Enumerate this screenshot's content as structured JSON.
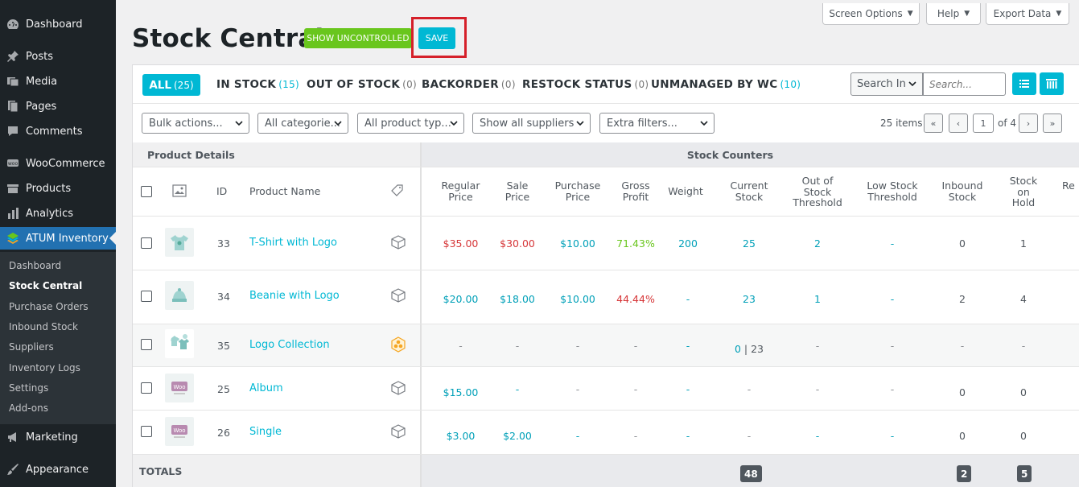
{
  "sidebar": {
    "items": [
      {
        "label": "Dashboard",
        "icon": "dashboard-icon"
      },
      {
        "label": "Posts",
        "icon": "pin-icon"
      },
      {
        "label": "Media",
        "icon": "media-icon"
      },
      {
        "label": "Pages",
        "icon": "pages-icon"
      },
      {
        "label": "Comments",
        "icon": "comments-icon"
      },
      {
        "label": "WooCommerce",
        "icon": "woo-icon"
      },
      {
        "label": "Products",
        "icon": "products-icon"
      },
      {
        "label": "Analytics",
        "icon": "analytics-icon"
      },
      {
        "label": "ATUM Inventory",
        "icon": "atum-layers-icon"
      },
      {
        "label": "Marketing",
        "icon": "megaphone-icon"
      },
      {
        "label": "Appearance",
        "icon": "paintbrush-icon"
      }
    ],
    "submenu": [
      "Dashboard",
      "Stock Central",
      "Purchase Orders",
      "Inbound Stock",
      "Suppliers",
      "Inventory Logs",
      "Settings",
      "Add-ons"
    ],
    "current_submenu": "Stock Central"
  },
  "top_buttons": {
    "screen_options": "Screen Options",
    "help": "Help",
    "export": "Export Data"
  },
  "page_title": "Stock Central",
  "buttons": {
    "show_uncontrolled": "SHOW UNCONTROLLED",
    "save": "SAVE"
  },
  "views": [
    {
      "label": "ALL",
      "count": "(25)"
    },
    {
      "label": "IN STOCK",
      "count": "(15)"
    },
    {
      "label": "OUT OF STOCK",
      "count": "(0)"
    },
    {
      "label": "BACKORDER",
      "count": "(0)"
    },
    {
      "label": "RESTOCK STATUS",
      "count": "(0)"
    },
    {
      "label": "UNMANAGED BY WC",
      "count": "(10)"
    }
  ],
  "search": {
    "select_label": "Search In",
    "placeholder": "Search..."
  },
  "filters": [
    "Bulk actions...",
    "All categorie...",
    "All product typ...",
    "Show all suppliers",
    "Extra filters..."
  ],
  "pagination": {
    "items": "25 items",
    "first": "«",
    "prev": "‹",
    "current": "1",
    "of": "of 4",
    "next": "›",
    "last": "»"
  },
  "table": {
    "group_left": "Product Details",
    "group_right": "Stock Counters",
    "headers": {
      "id": "ID",
      "name": "Product Name",
      "regular_price": [
        "Regular",
        "Price"
      ],
      "sale_price": [
        "Sale",
        "Price"
      ],
      "purchase_price": [
        "Purchase",
        "Price"
      ],
      "gross_profit": [
        "Gross",
        "Profit"
      ],
      "weight": [
        "Weight"
      ],
      "current_stock": [
        "Current",
        "Stock"
      ],
      "out_of_stock_threshold": [
        "Out of",
        "Stock",
        "Threshold"
      ],
      "low_stock_threshold": [
        "Low Stock",
        "Threshold"
      ],
      "inbound_stock": [
        "Inbound",
        "Stock"
      ],
      "stock_on_hold": [
        "Stock",
        "on",
        "Hold"
      ],
      "cut": "Re"
    },
    "rows": [
      {
        "id": "33",
        "name": "T-Shirt with Logo",
        "regular": "$35.00",
        "sale": "$30.00",
        "purchase": "$10.00",
        "gross": "71.43%",
        "weight": "200",
        "current": "25",
        "current_extra": "",
        "oost": "2",
        "lowst": "-",
        "inbound": "0",
        "hold": "1",
        "type_icon": "box-icon"
      },
      {
        "id": "34",
        "name": "Beanie with Logo",
        "regular": "$20.00",
        "sale": "$18.00",
        "purchase": "$10.00",
        "gross": "44.44%",
        "weight": "-",
        "current": "23",
        "current_extra": "",
        "oost": "1",
        "lowst": "-",
        "inbound": "2",
        "hold": "4",
        "type_icon": "box-icon"
      },
      {
        "id": "35",
        "name": "Logo Collection",
        "regular": "-",
        "sale": "-",
        "purchase": "-",
        "gross": "-",
        "weight": "-",
        "current": "0",
        "current_extra": "| 23",
        "oost": "-",
        "lowst": "-",
        "inbound": "-",
        "hold": "-",
        "type_icon": "grouped-icon"
      },
      {
        "id": "25",
        "name": "Album",
        "regular": "$15.00",
        "sale": "-",
        "purchase": "-",
        "gross": "-",
        "weight": "-",
        "current": "-",
        "current_extra": "",
        "oost": "-",
        "lowst": "-",
        "inbound": "0",
        "hold": "0",
        "type_icon": "box-icon"
      },
      {
        "id": "26",
        "name": "Single",
        "regular": "$3.00",
        "sale": "$2.00",
        "purchase": "-",
        "gross": "-",
        "weight": "-",
        "current": "-",
        "current_extra": "",
        "oost": "-",
        "lowst": "-",
        "inbound": "0",
        "hold": "0",
        "type_icon": "box-icon"
      }
    ],
    "totals": {
      "label": "TOTALS",
      "current": "48",
      "inbound": "2",
      "hold": "5"
    }
  },
  "colors": {
    "accent": "#00b8d4",
    "green": "#69c61d",
    "red": "#d63638",
    "sidebar": "#1d2327",
    "active": "#2271b1"
  }
}
